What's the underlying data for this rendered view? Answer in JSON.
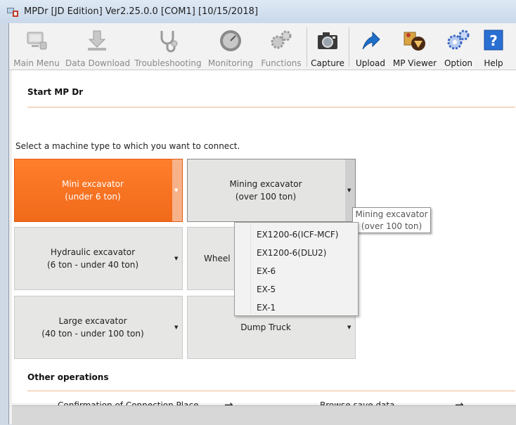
{
  "window": {
    "title": "MPDr [JD Edition] Ver2.25.0.0 [COM1] [10/15/2018]"
  },
  "toolbar": {
    "main_menu": "Main Menu",
    "data_download": "Data Download",
    "troubleshooting": "Troubleshooting",
    "monitoring": "Monitoring",
    "functions": "Functions",
    "capture": "Capture",
    "upload": "Upload",
    "mp_viewer": "MP Viewer",
    "option": "Option",
    "help": "Help"
  },
  "start": {
    "title": "Start MP Dr",
    "prompt": "Select a machine type to which you want to connect."
  },
  "machines": {
    "mini": {
      "line1": "Mini excavator",
      "line2": "(under 6 ton)"
    },
    "mining": {
      "line1": "Mining excavator",
      "line2": "(over 100 ton)"
    },
    "hydraulic": {
      "line1": "Hydraulic excavator",
      "line2": "(6 ton - under 40 ton)"
    },
    "wheel": {
      "line1": "Wheel"
    },
    "large": {
      "line1": "Large excavator",
      "line2": "(40 ton - under 100 ton)"
    },
    "dump": {
      "line1": "Dump Truck"
    }
  },
  "tooltip": {
    "line1": "Mining excavator",
    "line2": "(over 100 ton)"
  },
  "mining_menu": [
    "EX1200-6(ICF-MCF)",
    "EX1200-6(DLU2)",
    "EX-6",
    "EX-5",
    "EX-1"
  ],
  "other": {
    "title": "Other operations",
    "confirmation": "Confirmation of Connection Place",
    "browse": "Browse save data",
    "arrow": "→"
  },
  "dropdown_glyph": "▼",
  "colors": {
    "accent": "#f26f1f",
    "section_line": "#f0b890"
  }
}
